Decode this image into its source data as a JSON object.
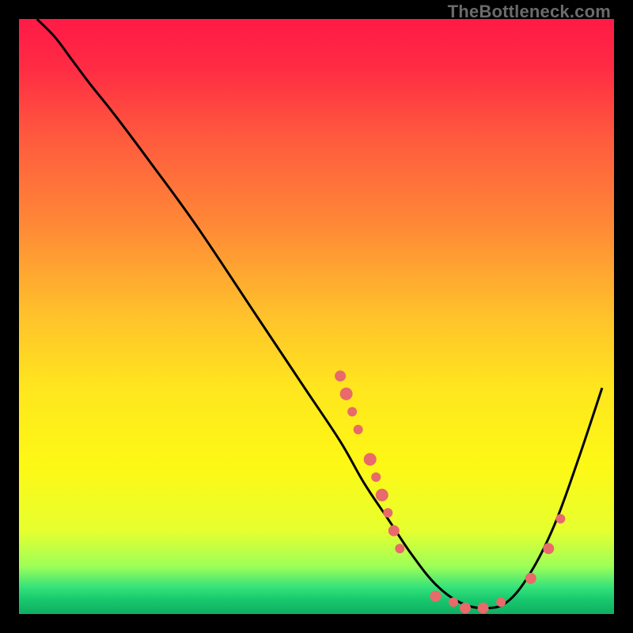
{
  "watermark": "TheBottleneck.com",
  "chart_data": {
    "type": "line",
    "title": "",
    "xlabel": "",
    "ylabel": "",
    "xlim": [
      0,
      100
    ],
    "ylim": [
      0,
      100
    ],
    "grid": false,
    "legend": false,
    "gradient_stops": [
      {
        "offset": 0.0,
        "color": "#ff1a46"
      },
      {
        "offset": 0.08,
        "color": "#ff2b44"
      },
      {
        "offset": 0.2,
        "color": "#ff5a3e"
      },
      {
        "offset": 0.35,
        "color": "#ff8a36"
      },
      {
        "offset": 0.5,
        "color": "#ffc22b"
      },
      {
        "offset": 0.62,
        "color": "#ffe61e"
      },
      {
        "offset": 0.75,
        "color": "#fdf815"
      },
      {
        "offset": 0.86,
        "color": "#e6ff2f"
      },
      {
        "offset": 0.92,
        "color": "#9dff58"
      },
      {
        "offset": 0.955,
        "color": "#35e27a"
      },
      {
        "offset": 0.975,
        "color": "#19c96e"
      },
      {
        "offset": 1.0,
        "color": "#0fae61"
      }
    ],
    "series": [
      {
        "name": "bottleneck-curve",
        "stroke": "#000000",
        "x": [
          3,
          6,
          9,
          12,
          16,
          22,
          30,
          40,
          48,
          54,
          58,
          62,
          66,
          70,
          74,
          78,
          82,
          86,
          90,
          94,
          98
        ],
        "y": [
          100,
          97,
          93,
          89,
          84,
          76,
          65,
          50,
          38,
          29,
          22,
          16,
          10,
          5,
          2,
          1,
          2,
          7,
          15,
          26,
          38
        ]
      }
    ],
    "scatter": {
      "name": "highlight-points",
      "fill": "#e86a6a",
      "points": [
        {
          "x": 54,
          "y": 40,
          "r": 7
        },
        {
          "x": 55,
          "y": 37,
          "r": 8
        },
        {
          "x": 56,
          "y": 34,
          "r": 6
        },
        {
          "x": 57,
          "y": 31,
          "r": 6
        },
        {
          "x": 59,
          "y": 26,
          "r": 8
        },
        {
          "x": 60,
          "y": 23,
          "r": 6
        },
        {
          "x": 61,
          "y": 20,
          "r": 8
        },
        {
          "x": 62,
          "y": 17,
          "r": 6
        },
        {
          "x": 63,
          "y": 14,
          "r": 7
        },
        {
          "x": 64,
          "y": 11,
          "r": 6
        },
        {
          "x": 70,
          "y": 3,
          "r": 7
        },
        {
          "x": 73,
          "y": 2,
          "r": 6
        },
        {
          "x": 75,
          "y": 1,
          "r": 7
        },
        {
          "x": 78,
          "y": 1,
          "r": 7
        },
        {
          "x": 81,
          "y": 2,
          "r": 6
        },
        {
          "x": 86,
          "y": 6,
          "r": 7
        },
        {
          "x": 89,
          "y": 11,
          "r": 7
        },
        {
          "x": 91,
          "y": 16,
          "r": 6
        }
      ]
    }
  }
}
